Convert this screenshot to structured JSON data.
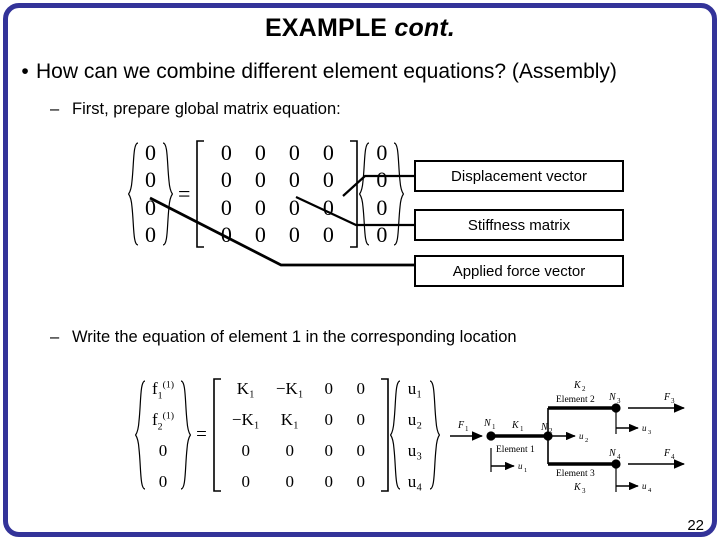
{
  "slide": {
    "title_main": "EXAMPLE",
    "title_italic": "cont.",
    "page_number": "22",
    "border_color": "#333399"
  },
  "bullets": {
    "level1": "How can we combine different element equations? (Assembly)",
    "level1_marker": "•",
    "level2_a": "First, prepare global matrix equation:",
    "level2_b": "Write the equation of element 1 in the corresponding location",
    "level2_marker": "–"
  },
  "equation1": {
    "lhs_vector": [
      "0",
      "0",
      "0",
      "0"
    ],
    "equals": "=",
    "matrix": [
      [
        "0",
        "0",
        "0",
        "0"
      ],
      [
        "0",
        "0",
        "0",
        "0"
      ],
      [
        "0",
        "0",
        "0",
        "0"
      ],
      [
        "0",
        "0",
        "0",
        "0"
      ]
    ],
    "rhs_vector": [
      "0",
      "0",
      "0",
      "0"
    ]
  },
  "callouts": {
    "displacement": "Displacement vector",
    "stiffness": "Stiffness matrix",
    "force": "Applied force vector"
  },
  "equation2": {
    "lhs_vector": [
      "f₁⁽¹⁾",
      "f₂⁽¹⁾",
      "0",
      "0"
    ],
    "lhs_vector_parts": [
      {
        "base": "f",
        "sub": "1",
        "sup": "(1)"
      },
      {
        "base": "f",
        "sub": "2",
        "sup": "(1)"
      },
      {
        "base": "0",
        "sub": "",
        "sup": ""
      },
      {
        "base": "0",
        "sub": "",
        "sup": ""
      }
    ],
    "equals": "=",
    "matrix": [
      [
        "K₁",
        "−K₁",
        "0",
        "0"
      ],
      [
        "−K₁",
        "K₁",
        "0",
        "0"
      ],
      [
        "0",
        "0",
        "0",
        "0"
      ],
      [
        "0",
        "0",
        "0",
        "0"
      ]
    ],
    "rhs_vector": [
      "u₁",
      "u₂",
      "u₃",
      "u₄"
    ]
  },
  "diagram": {
    "nodes": [
      "N₁",
      "N₂",
      "N₃",
      "N₄"
    ],
    "springs": [
      "K₁",
      "K₂",
      "K₃"
    ],
    "elements": [
      "Element 1",
      "Element 2",
      "Element 3"
    ],
    "forces": [
      "F₁",
      "F₃",
      "F₄"
    ],
    "displacements": [
      "u₁",
      "u₂",
      "u₃",
      "u₄"
    ]
  }
}
